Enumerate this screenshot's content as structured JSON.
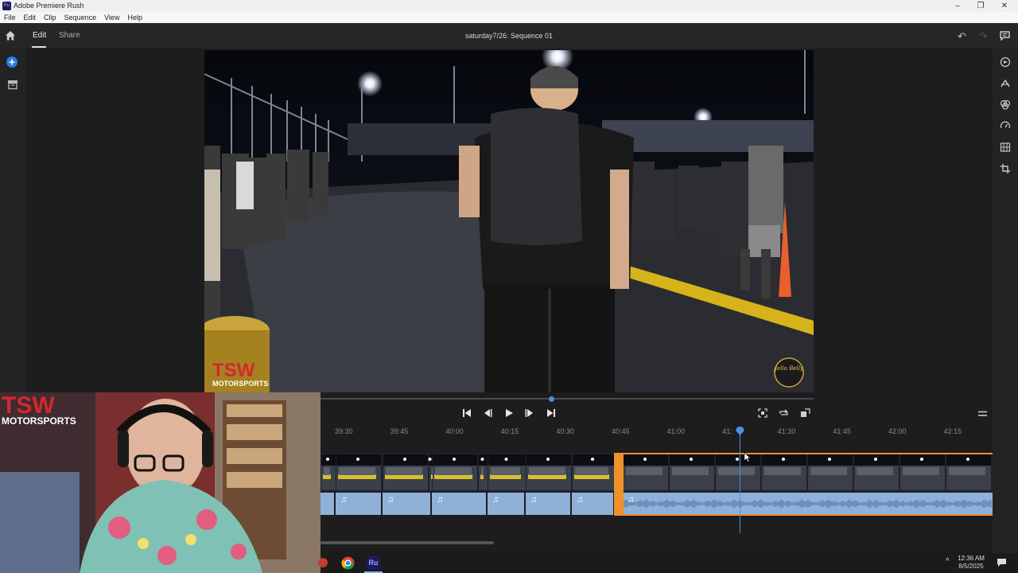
{
  "window": {
    "title": "Adobe Premiere Rush",
    "icon_label": "Ru",
    "controls": [
      "–",
      "❐",
      "✕"
    ]
  },
  "menu": [
    "File",
    "Edit",
    "Clip",
    "Sequence",
    "View",
    "Help"
  ],
  "header": {
    "tabs": [
      {
        "label": "Edit",
        "active": true
      },
      {
        "label": "Share",
        "active": false
      }
    ],
    "sequence_title": "saturday7/26: Sequence 01"
  },
  "preview": {
    "overlay_brand": "TSW",
    "overlay_sub": "MOTORSPORTS",
    "watermark": "Jello Belly"
  },
  "timeline": {
    "ticks": [
      "39:30",
      "39:45",
      "40:00",
      "40:15",
      "40:30",
      "40:45",
      "41:00",
      "41:",
      "41:30",
      "41:45",
      "42:00",
      "42:15"
    ],
    "playhead_fraction": 0.52
  },
  "webcam": {
    "brand": "TSW",
    "sub": "MOTORSPORTS"
  },
  "taskbar": {
    "apps": [
      {
        "name": "chrome-icon"
      },
      {
        "name": "premiere-rush-icon",
        "label": "Ru"
      }
    ],
    "time": "12:36 AM",
    "date": "8/5/2025"
  },
  "colors": {
    "accent": "#4a90e2",
    "selection": "#f0922b",
    "audio_clip": "#8fb1d9"
  }
}
